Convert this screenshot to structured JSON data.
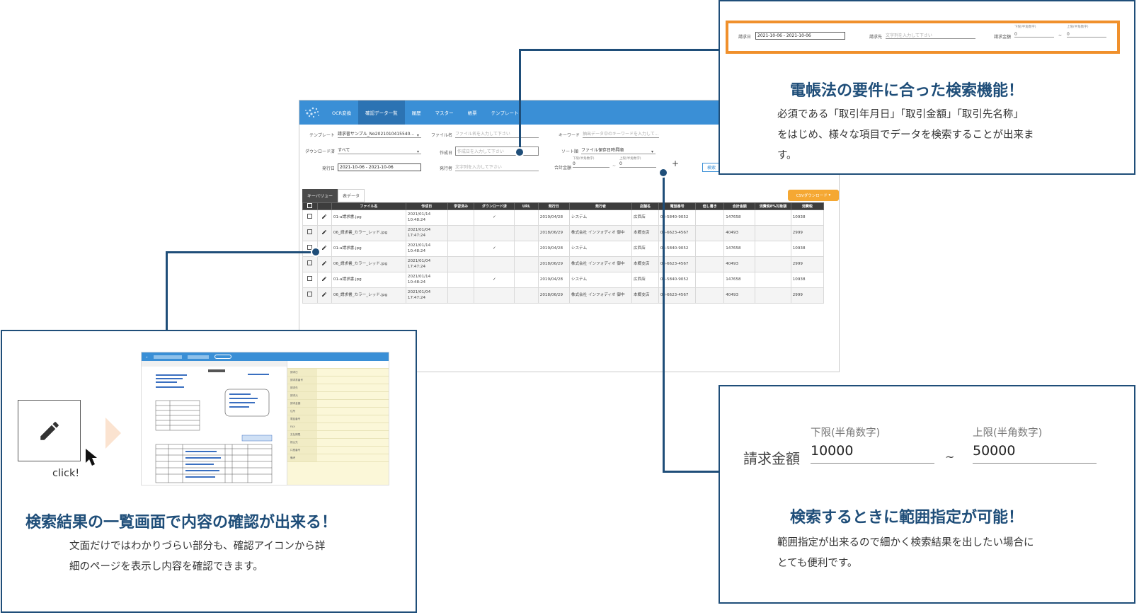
{
  "app": {
    "nav": [
      "OCR変換",
      "確認データ一覧",
      "履歴",
      "マスター",
      "帳票",
      "テンプレート"
    ],
    "nav_active_index": 1,
    "filters": {
      "template_label": "テンプレート",
      "template_value": "請求書サンプル_No2021010415540...",
      "filename_label": "ファイル名",
      "filename_placeholder": "ファイル名を入力して下さい",
      "keyword_label": "キーワード",
      "keyword_placeholder": "抽出データ中のキーワードを入力して...",
      "download_label": "ダウンロード済",
      "download_value": "すべて",
      "created_label": "作成日",
      "created_placeholder": "作成日を入力して下さい",
      "sort_label": "ソート順",
      "sort_value": "ファイル保存日時昇順",
      "issue_date_label": "発行日",
      "issue_date_value": "2021-10-06 - 2021-10-06",
      "issuer_label": "発行者",
      "issuer_placeholder": "文字列を入力して下さい",
      "total_label": "合計金額",
      "lower_label": "下限(半角数字)",
      "upper_label": "上限(半角数字)",
      "lower_value": "0",
      "upper_value": "0",
      "range_sep": "~",
      "plus": "+",
      "search_button": "検索"
    },
    "tabs": [
      "キーバリュー",
      "表データ"
    ],
    "csv_button": "CSVダウンロード",
    "columns": [
      "",
      "",
      "ファイル名",
      "作成日",
      "学習済み",
      "ダウンロード済",
      "URL",
      "発行日",
      "発行者",
      "店舗名",
      "電話番号",
      "但し書き",
      "合計金額",
      "消費税8%対象額",
      "消費税"
    ],
    "rows": [
      {
        "file": "01-a請求書.jpg",
        "created": "2021/01/14 10:48:24",
        "dl": "✓",
        "issue": "2019/04/28",
        "issuer": "システム",
        "store": "広西店",
        "tel": "03-5840-9052",
        "total": "147658",
        "tax": "10938"
      },
      {
        "file": "06_請求書_カラー_レッド.jpg",
        "created": "2021/01/04 17:47:24",
        "dl": "",
        "issue": "2018/06/29",
        "issuer": "株式会社 インフォディオ 御中",
        "store": "本郷支店",
        "tel": "03-6623-4567",
        "total": "40493",
        "tax": "2999"
      },
      {
        "file": "01-a請求書.jpg",
        "created": "2021/01/14 10:48:24",
        "dl": "✓",
        "issue": "2019/04/28",
        "issuer": "システム",
        "store": "広西店",
        "tel": "03-5840-9052",
        "total": "147658",
        "tax": "10938"
      },
      {
        "file": "06_請求書_カラー_レッド.jpg",
        "created": "2021/01/04 17:47:24",
        "dl": "",
        "issue": "2018/06/29",
        "issuer": "株式会社 インフォディオ 御中",
        "store": "本郷支店",
        "tel": "03-6623-4567",
        "total": "40493",
        "tax": "2999"
      },
      {
        "file": "01-a請求書.jpg",
        "created": "2021/01/14 10:48:24",
        "dl": "✓",
        "issue": "2019/04/28",
        "issuer": "システム",
        "store": "広西店",
        "tel": "03-5840-9052",
        "total": "147658",
        "tax": "10938"
      },
      {
        "file": "06_請求書_カラー_レッド.jpg",
        "created": "2021/01/04 17:47:24",
        "dl": "",
        "issue": "2018/06/29",
        "issuer": "株式会社 インフォディオ 御中",
        "store": "本郷支店",
        "tel": "03-6623-4567",
        "total": "40493",
        "tax": "2999"
      }
    ]
  },
  "callout_top": {
    "strip": {
      "date_label": "請求日",
      "date_value": "2021-10-06 - 2021-10-06",
      "to_label": "請求先",
      "to_placeholder": "文字列を入力して下さい",
      "amount_label": "請求金額",
      "lower_label": "下限(半角数字)",
      "upper_label": "上限(半角数字)",
      "lower_value": "0",
      "upper_value": "0",
      "sep": "~"
    },
    "title": "電帳法の要件に合った検索機能！",
    "desc_line1": "必須である「取引年月日」「取引金額」「取引先名称」",
    "desc_line2": "をはじめ、様々な項目でデータを検索することが出来ま",
    "desc_line3": "す。"
  },
  "callout_right": {
    "amount_label": "請求金額",
    "lower_label": "下限(半角数字)",
    "upper_label": "上限(半角数字)",
    "lower_value": "10000",
    "upper_value": "50000",
    "sep": "~",
    "title": "検索するときに範囲指定が可能！",
    "desc_line1": "範囲指定が出来るので細かく検索結果を出したい場合に",
    "desc_line2": "とても便利です。"
  },
  "callout_left": {
    "click_label": "click!",
    "title": "検索結果の一覧画面で内容の確認が出来る！",
    "desc_line1": "文面だけではわかりづらい部分も、確認アイコンから詳",
    "desc_line2": "細のページを表示し内容を確認できます。",
    "shot_panel_rows": [
      "請求日",
      "請求書番号",
      "請求先",
      "請求元",
      "請求金額",
      "住所",
      "電話番号",
      "FAX",
      "支払期限",
      "振込先",
      "口座番号",
      "備考"
    ]
  },
  "colors": {
    "accent": "#1f4e79",
    "topbar": "#3a8fd6",
    "highlight": "#f0902c",
    "csv": "#f5a833"
  }
}
